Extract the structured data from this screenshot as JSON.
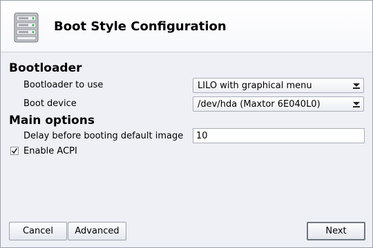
{
  "header": {
    "title": "Boot Style Configuration",
    "icon": "server-icon"
  },
  "bootloader_section": {
    "title": "Bootloader",
    "bootloader_label": "Bootloader to use",
    "bootloader_value": "LILO with graphical menu",
    "device_label": "Boot device",
    "device_value": "/dev/hda (Maxtor 6E040L0)"
  },
  "main_options": {
    "title": "Main options",
    "delay_label": "Delay before booting default image",
    "delay_value": "10",
    "acpi_label": "Enable ACPI",
    "acpi_checked": true
  },
  "buttons": {
    "cancel": "Cancel",
    "advanced": "Advanced",
    "next": "Next"
  }
}
